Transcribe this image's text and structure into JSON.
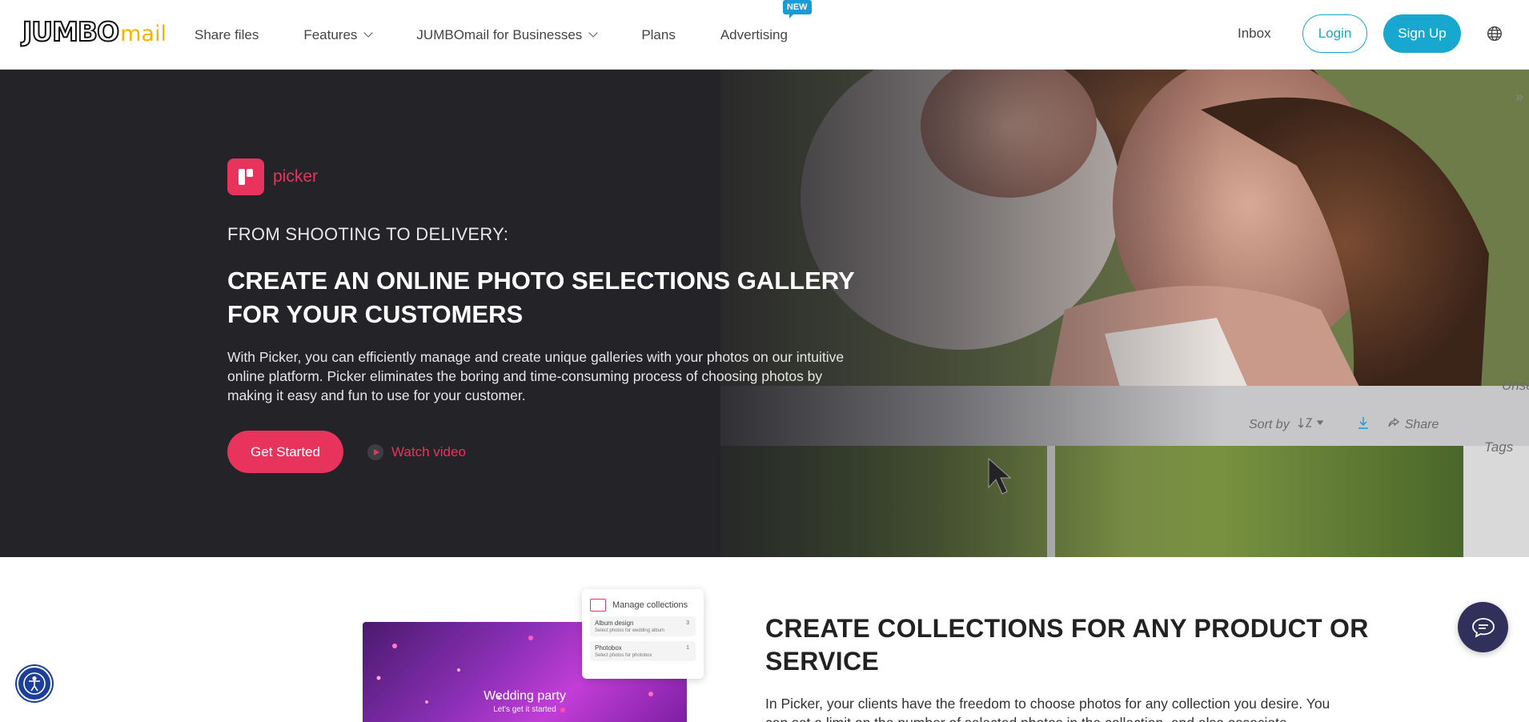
{
  "header": {
    "logo_main": "JUMBO",
    "logo_sub": "mail",
    "nav": [
      {
        "label": "Share files"
      },
      {
        "label": "Features"
      },
      {
        "label": "JUMBOmail for Businesses"
      },
      {
        "label": "Plans"
      },
      {
        "label": "Advertising",
        "badge": "NEW"
      }
    ],
    "inbox_label": "Inbox",
    "login_label": "Login",
    "signup_label": "Sign Up"
  },
  "hero": {
    "brand_name": "picker",
    "eyebrow": "FROM SHOOTING TO DELIVERY:",
    "title": "CREATE AN ONLINE PHOTO SELECTIONS GALLERY FOR YOUR CUSTOMERS",
    "description": "With Picker, you can efficiently manage and create unique galleries with your photos on our intuitive online platform. Picker eliminates the boring and time-consuming process of choosing photos by making it easy and fun to use for your customer.",
    "cta_label": "Get Started",
    "watch_label": "Watch video",
    "mock_sort_label": "Sort by",
    "mock_share_label": "Share",
    "mock_tags_label": "Tags",
    "mock_unselected_label": "Unse"
  },
  "section2": {
    "title": "CREATE COLLECTIONS FOR ANY PRODUCT OR SERVICE",
    "description": "In Picker, your clients have the freedom to choose photos for any collection you desire. You can set a limit on the number of selected photos in the collection, and also associate",
    "card_title": "Wedding party",
    "card_subtitle": "Let's get it started",
    "manage": {
      "heading": "Manage collections",
      "rows": [
        {
          "title": "Album design",
          "subtitle": "Select photos for wedding album",
          "count": "3"
        },
        {
          "title": "Photobox",
          "subtitle": "Select photos for photobox",
          "count": "1"
        }
      ]
    }
  },
  "colors": {
    "accent_blue": "#18a7cf",
    "picker_pink": "#e8345d",
    "logo_yellow": "#f4b400",
    "hero_dark": "#26252a",
    "chat_navy": "#30305a",
    "accessibility_blue": "#1d3f9c"
  },
  "icons": [
    "globe-icon",
    "picker-logo-icon",
    "play-icon",
    "chevron-down-icon",
    "accessibility-icon",
    "chat-icon",
    "sort-icon",
    "download-icon",
    "share-icon",
    "close-icon"
  ]
}
